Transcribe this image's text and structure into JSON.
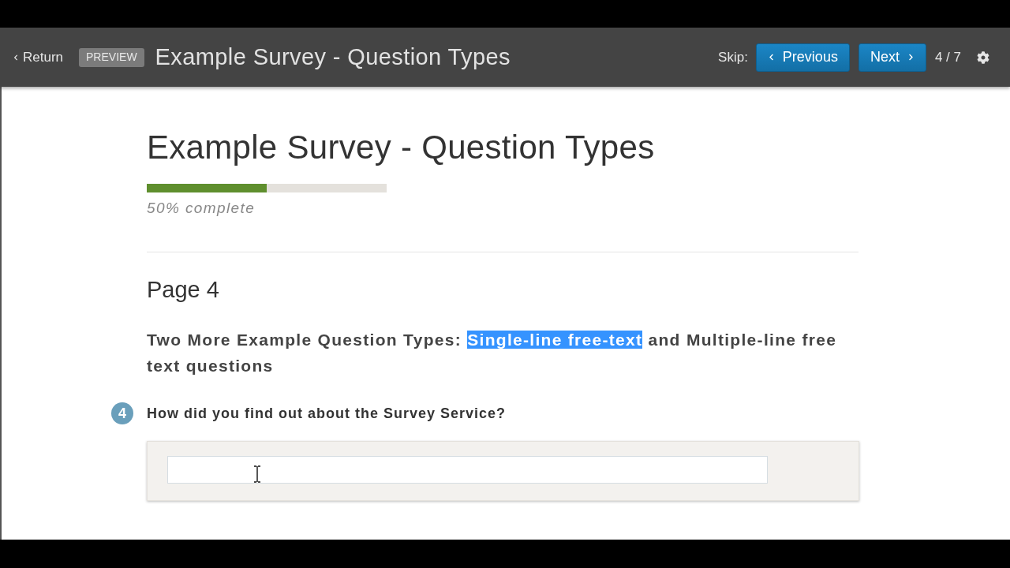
{
  "header": {
    "return_link": "Return",
    "badge": "PREVIEW",
    "title": "Example Survey - Question Types",
    "skip_label": "Skip:",
    "buttons": [
      {
        "kind": "previous",
        "label": "Previous"
      },
      {
        "kind": "next",
        "label": "Next"
      }
    ],
    "page_count": "4 / 7"
  },
  "survey": {
    "title": "Example Survey - Question Types",
    "progress": {
      "level": 0.5,
      "label": "50% complete"
    },
    "page_title": "Page 4",
    "section_heading": [
      {
        "text": "Two More Example Question Types: ",
        "selected": false
      },
      {
        "text": "Single-line free-text",
        "selected": true
      },
      {
        "text": " and Multiple-line free text questions",
        "selected": false
      }
    ],
    "questions": [
      {
        "number": "4",
        "text": "How did you find out about the Survey Service?",
        "kind": "single_line"
      }
    ]
  }
}
